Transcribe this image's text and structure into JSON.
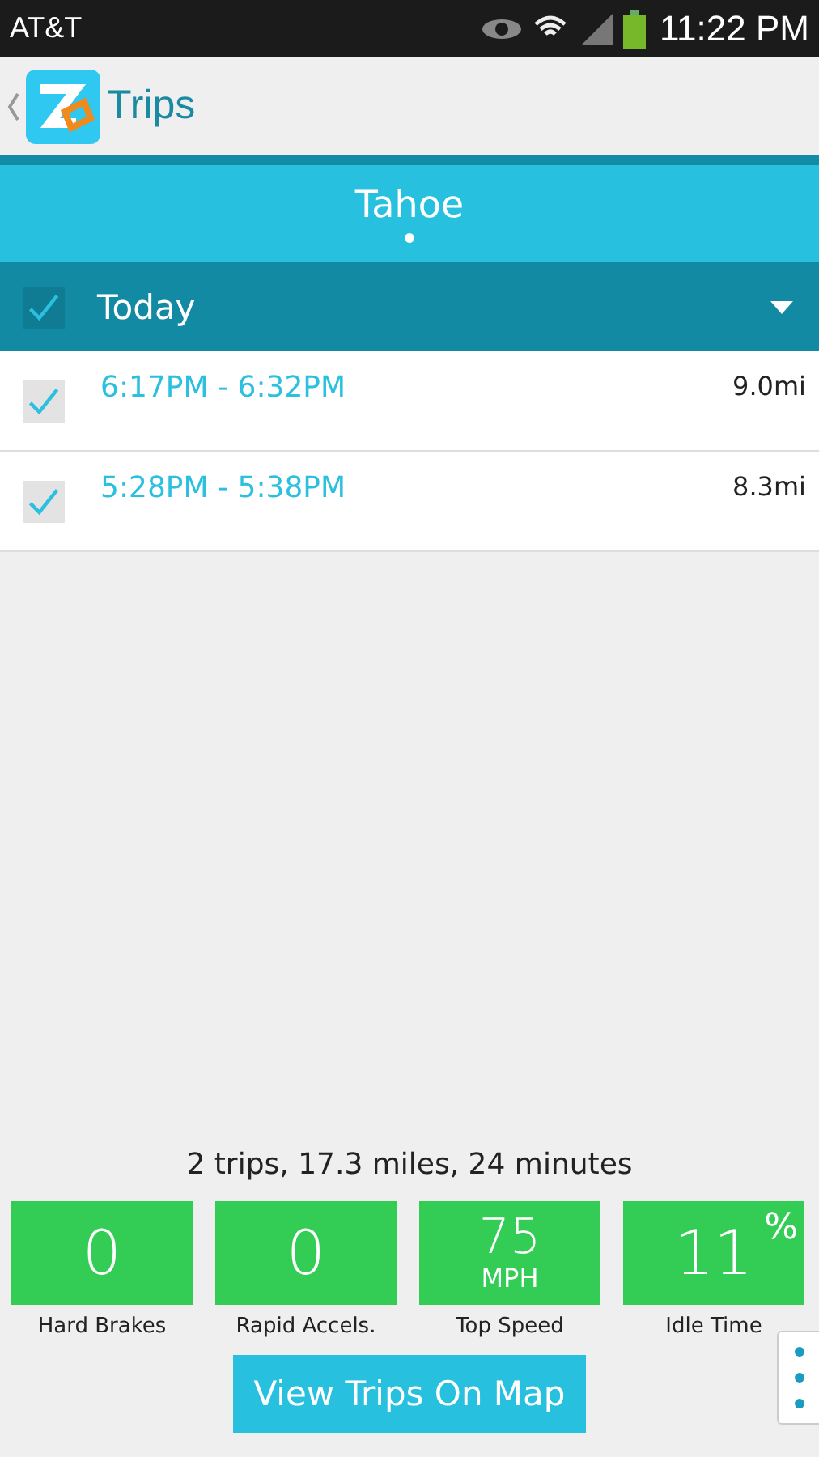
{
  "status_bar": {
    "carrier": "AT&T",
    "time": "11:22 PM"
  },
  "app_bar": {
    "title": "Trips"
  },
  "vehicle": {
    "name": "Tahoe"
  },
  "group": {
    "label": "Today",
    "checked": true
  },
  "trips": [
    {
      "time": "6:17PM - 6:32PM",
      "distance": "9.0mi",
      "checked": true
    },
    {
      "time": "5:28PM - 5:38PM",
      "distance": "8.3mi",
      "checked": true
    }
  ],
  "summary": "2 trips, 17.3 miles, 24 minutes",
  "stats": [
    {
      "value": "0",
      "label": "Hard Brakes"
    },
    {
      "value": "0",
      "label": "Rapid Accels."
    },
    {
      "value": "75",
      "unit": "MPH",
      "label": "Top Speed"
    },
    {
      "value": "11",
      "suffix": "%",
      "label": "Idle Time"
    }
  ],
  "map_button": "View Trips On Map"
}
